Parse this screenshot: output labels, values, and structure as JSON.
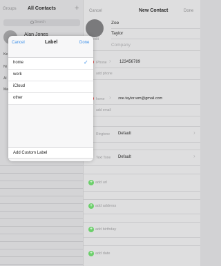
{
  "left_pane": {
    "groups_label": "Groups",
    "title": "All Contacts",
    "add_icon": "plus-icon",
    "search_placeholder": "Search",
    "contact_name": "Alan Jones",
    "truncated_labels": [
      "Ke",
      "Ni",
      "Al",
      "Ma"
    ]
  },
  "new_contact": {
    "cancel_label": "Cancel",
    "title": "New Contact",
    "done_label": "Done",
    "photo_edit_label": "edit",
    "first_name": "Zoe",
    "last_name": "Taylor",
    "company_placeholder": "Company",
    "phone": {
      "label": "iPhone",
      "value": "123456789",
      "add_label": "add phone"
    },
    "email": {
      "label": "home",
      "value": "zoe.taylor.wm@gmail.com",
      "add_label": "add email"
    },
    "ringtone": {
      "label": "Ringtone",
      "value": "Default"
    },
    "text_tone": {
      "label": "Text Tone",
      "value": "Default"
    },
    "add_rows": [
      "add url",
      "add address",
      "add birthday",
      "add date"
    ]
  },
  "label_popover": {
    "cancel_label": "Cancel",
    "title": "Label",
    "done_label": "Done",
    "options": [
      {
        "label": "home",
        "selected": true
      },
      {
        "label": "work",
        "selected": false
      },
      {
        "label": "iCloud",
        "selected": false
      },
      {
        "label": "other",
        "selected": false
      }
    ],
    "custom_label": "Add Custom Label",
    "check_glyph": "✓"
  },
  "colors": {
    "accent_blue": "#3a8ee8",
    "delete_red": "#e24b4b",
    "add_green": "#6ccf6b"
  }
}
